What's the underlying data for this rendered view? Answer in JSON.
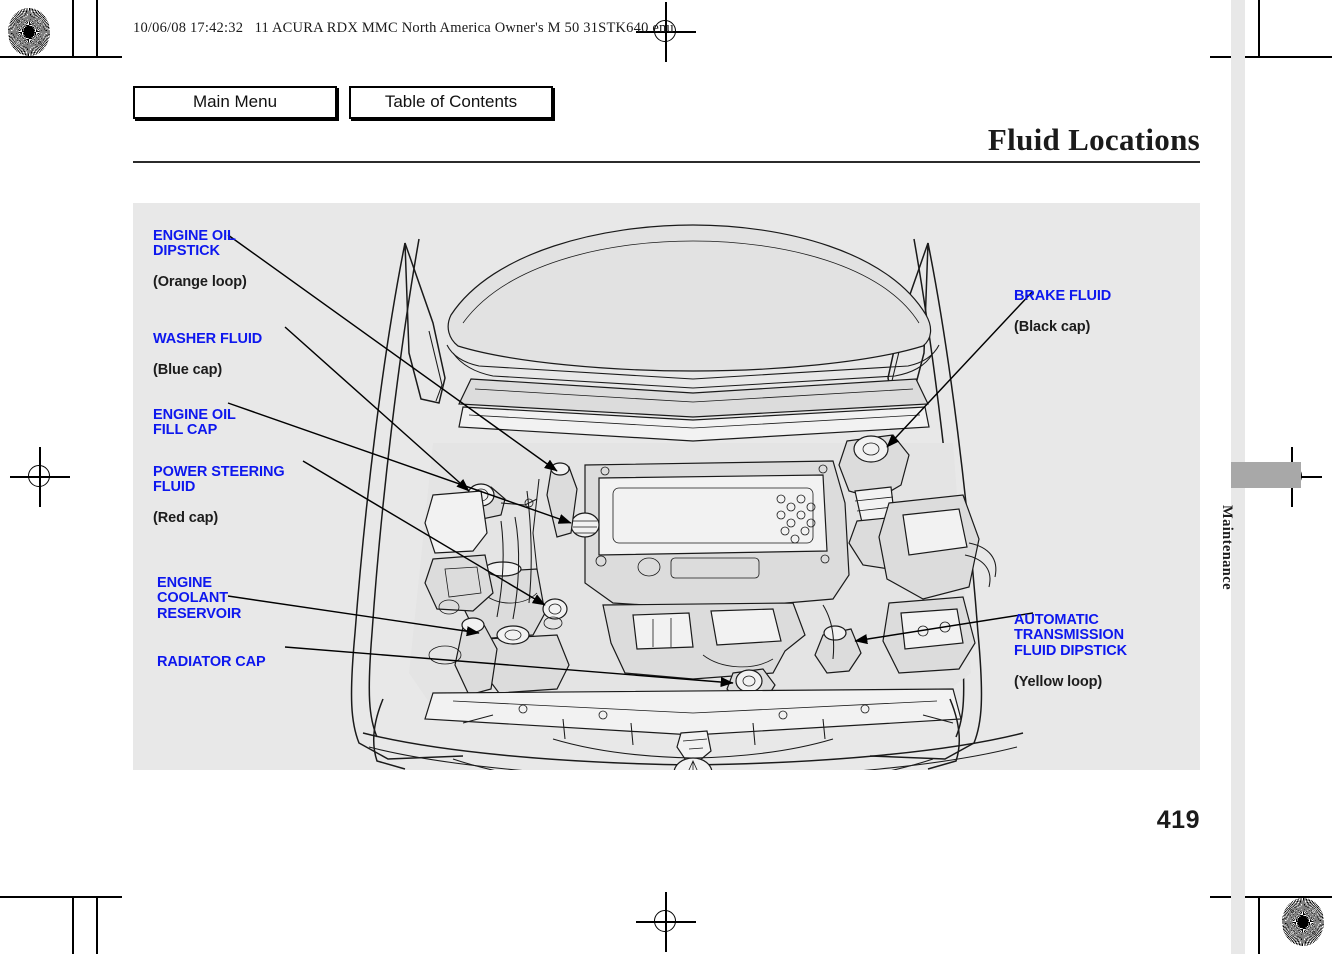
{
  "document": {
    "header_stamp": "10/06/08 17:42:32   11 ACURA RDX MMC North America Owner's M 50 31STK640 enu",
    "page_title": "Fluid Locations",
    "page_number": "419",
    "section_tab": "Maintenance"
  },
  "nav": {
    "main_menu": "Main Menu",
    "table_of_contents": "Table of Contents"
  },
  "figure": {
    "alt": "Engine bay diagram showing fluid reservoir locations",
    "panel_color": "#e8e8e8",
    "label_color": "#0d17ee",
    "sublabel_color": "#1c1c1c"
  },
  "callouts": [
    {
      "id": "engine-oil-dipstick",
      "label": "ENGINE OIL\nDIPSTICK",
      "sub": "(Orange loop)",
      "side": "left"
    },
    {
      "id": "washer-fluid",
      "label": "WASHER FLUID",
      "sub": "(Blue cap)",
      "side": "left"
    },
    {
      "id": "engine-oil-fill-cap",
      "label": "ENGINE OIL\nFILL CAP",
      "sub": "",
      "side": "left"
    },
    {
      "id": "power-steering-fluid",
      "label": "POWER STEERING\nFLUID",
      "sub": "(Red cap)",
      "side": "left"
    },
    {
      "id": "engine-coolant-reservoir",
      "label": "ENGINE\nCOOLANT\nRESERVOIR",
      "sub": "",
      "side": "left"
    },
    {
      "id": "radiator-cap",
      "label": "RADIATOR CAP",
      "sub": "",
      "side": "left"
    },
    {
      "id": "brake-fluid",
      "label": "BRAKE FLUID",
      "sub": "(Black cap)",
      "side": "right"
    },
    {
      "id": "automatic-transmission-fluid-dipstick",
      "label": "AUTOMATIC\nTRANSMISSION\nFLUID DIPSTICK",
      "sub": "(Yellow loop)",
      "side": "right"
    }
  ]
}
